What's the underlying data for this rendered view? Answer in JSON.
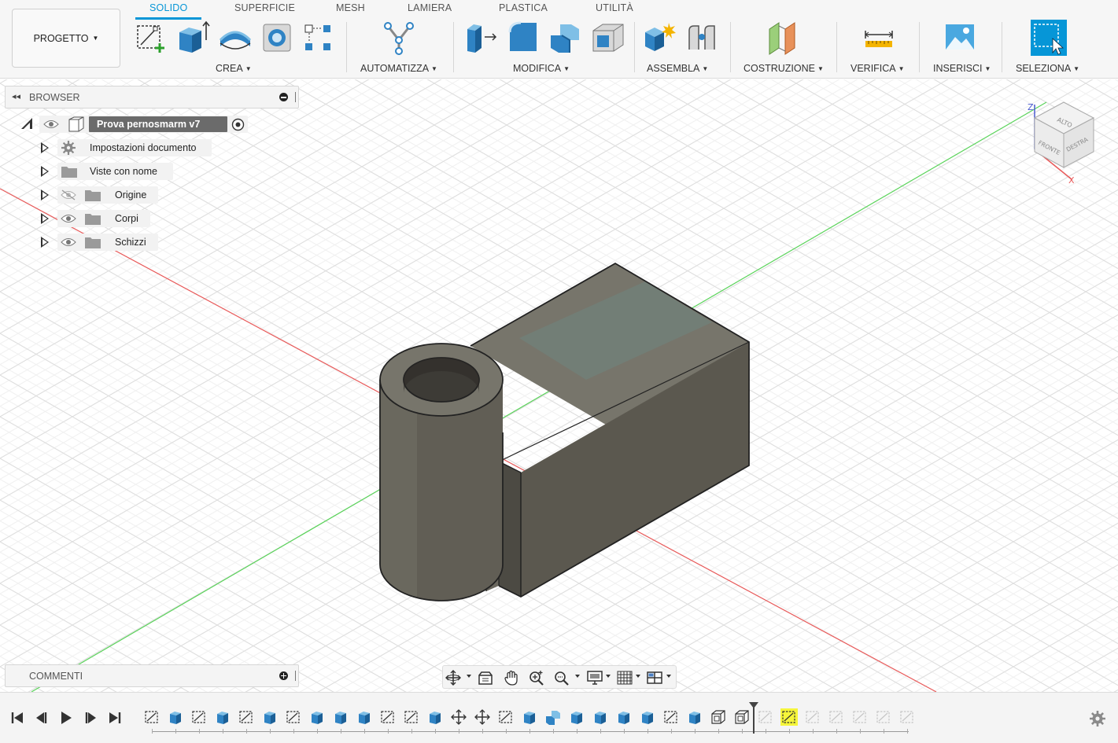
{
  "toolbar": {
    "project_label": "PROGETTO",
    "project_caret": "▼",
    "tabs": [
      {
        "label": "SOLIDO",
        "active": true
      },
      {
        "label": "SUPERFICIE",
        "active": false
      },
      {
        "label": "MESH",
        "active": false
      },
      {
        "label": "LAMIERA",
        "active": false
      },
      {
        "label": "PLASTICA",
        "active": false
      },
      {
        "label": "UTILITÀ",
        "active": false
      }
    ],
    "groups": [
      {
        "label": "CREA"
      },
      {
        "label": "AUTOMATIZZA"
      },
      {
        "label": "MODIFICA"
      },
      {
        "label": "ASSEMBLA"
      },
      {
        "label": "COSTRUZIONE"
      },
      {
        "label": "VERIFICA"
      },
      {
        "label": "INSERISCI"
      },
      {
        "label": "SELEZIONA"
      }
    ],
    "caret": "▼"
  },
  "browser": {
    "title": "BROWSER",
    "collapse_glyph": "◂◂",
    "root": {
      "label": "Prova pernosmarm v7"
    },
    "items": [
      {
        "label": "Impostazioni documento",
        "icon": "gear-icon"
      },
      {
        "label": "Viste con nome",
        "icon": "folder-icon"
      },
      {
        "label": "Origine",
        "icon": "folder-icon",
        "visibility": "hidden"
      },
      {
        "label": "Corpi",
        "icon": "folder-icon",
        "visibility": "visible"
      },
      {
        "label": "Schizzi",
        "icon": "folder-icon",
        "visibility": "visible"
      }
    ]
  },
  "comments": {
    "title": "COMMENTI"
  },
  "viewcube": {
    "top": "ALTO",
    "front": "FRONTE",
    "right": "DESTRA",
    "axis_z": "Z",
    "axis_x": "X"
  },
  "colors": {
    "accent": "#0696d7",
    "axis_red": "#e85a5a",
    "axis_green": "#5ad35a",
    "body_dark": "#5b584f",
    "highlight_yellow": "#f5f53a"
  }
}
